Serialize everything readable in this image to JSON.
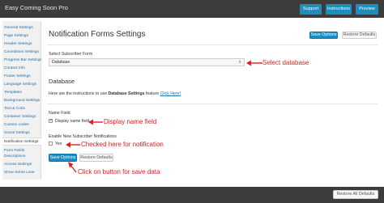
{
  "app": {
    "title": "Easy Coming Soon Pro"
  },
  "topbar": {
    "support": "Support",
    "instructions": "Instructions",
    "preview": "Preview"
  },
  "sidebar": {
    "items": [
      "General Settings",
      "Page Settings",
      "Header Settings",
      "Countdown Settings",
      "Progress Bar Settings",
      "Contact Info",
      "Footer Settings",
      "Language Settings",
      "Templates",
      "Background Settings",
      "Text & Color",
      "Container Settings",
      "Custom codes",
      "Social Settings",
      "Notification Settings",
      "Form Fields Descriptions",
      "Access Settings",
      "Show Some Love"
    ],
    "active_index": 14
  },
  "main": {
    "title": "Notification Forms Settings",
    "save_options": "Save Options",
    "restore_defaults": "Restore Defaults",
    "subscriber_form_label": "Select Subscriber Form",
    "subscriber_form_value": "Database",
    "database_heading": "Database",
    "instructions_prefix": "Here are the instructions to use ",
    "instructions_bold": "Database Settings",
    "instructions_mid": " feature ",
    "instructions_link": "Click Here!",
    "name_field_label": "Name Field",
    "name_field_option": "Display name field",
    "name_field_checked": true,
    "notifications_label": "Enable New Subscriber Notifications",
    "notifications_option": "Yes",
    "notifications_checked": false
  },
  "annotations": {
    "select_database": "Select database",
    "display_name": "Display name field",
    "checked_here": "Checked here for notification",
    "click_save": "Click on button for save data"
  },
  "footer": {
    "restore_all": "Restore All Defaults"
  },
  "colors": {
    "accent": "#1e8cbe",
    "annotation": "#e02020",
    "bar": "#3c3c3c"
  }
}
